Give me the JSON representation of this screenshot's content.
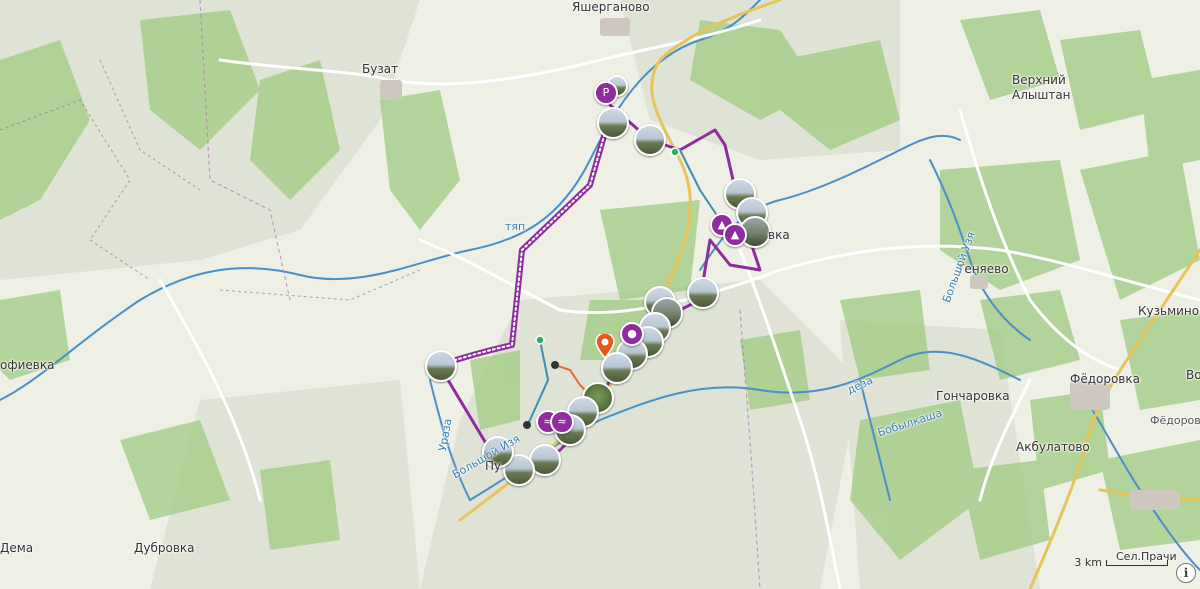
{
  "map": {
    "places": [
      {
        "id": "yashergan",
        "label": "Яшерганово"
      },
      {
        "id": "buzat",
        "label": "Бузат"
      },
      {
        "id": "verkhniy1",
        "label": "Верхний"
      },
      {
        "id": "verkhniy2",
        "label": "Алыштан"
      },
      {
        "id": "tenyaevo",
        "label": "Теняево"
      },
      {
        "id": "kuzminovka",
        "label": "Кузьминов"
      },
      {
        "id": "fedorovka",
        "label": "Фёдоровка"
      },
      {
        "id": "vo",
        "label": "Во"
      },
      {
        "id": "goncharovka",
        "label": "Гончаровка"
      },
      {
        "id": "akbulatovo",
        "label": "Акбулатово"
      },
      {
        "id": "fedorovka_road",
        "label": "Фёдоровка-"
      },
      {
        "id": "sofievka",
        "label": "офиевка"
      },
      {
        "id": "dema",
        "label": "Дема"
      },
      {
        "id": "dubrovka",
        "label": "Дубровка"
      },
      {
        "id": "vka",
        "label": "вка"
      },
      {
        "id": "tyap",
        "label": "тяп"
      },
      {
        "id": "pu",
        "label": "Пу"
      },
      {
        "id": "bolshoy_izyak",
        "label": "Большой Изя"
      },
      {
        "id": "bolshoy_uzyak",
        "label": "Большой Узя"
      },
      {
        "id": "deza",
        "label": "дёза"
      },
      {
        "id": "boblykasha",
        "label": "Бобылкаша"
      },
      {
        "id": "uraz",
        "label": "Ураза"
      },
      {
        "id": "sheltrashi",
        "label": "Сел.Прачи"
      }
    ],
    "scale": {
      "label": "3 km"
    },
    "info_label": "i",
    "colors": {
      "route_primary": "#8e2ca0",
      "route_secondary": "#3a8fb0",
      "river": "#4a90c8",
      "forest": "#a8cf8c",
      "road_main": "#e6c45a",
      "road_secondary": "#ffffff",
      "pin_orange": "#e8581c"
    }
  }
}
